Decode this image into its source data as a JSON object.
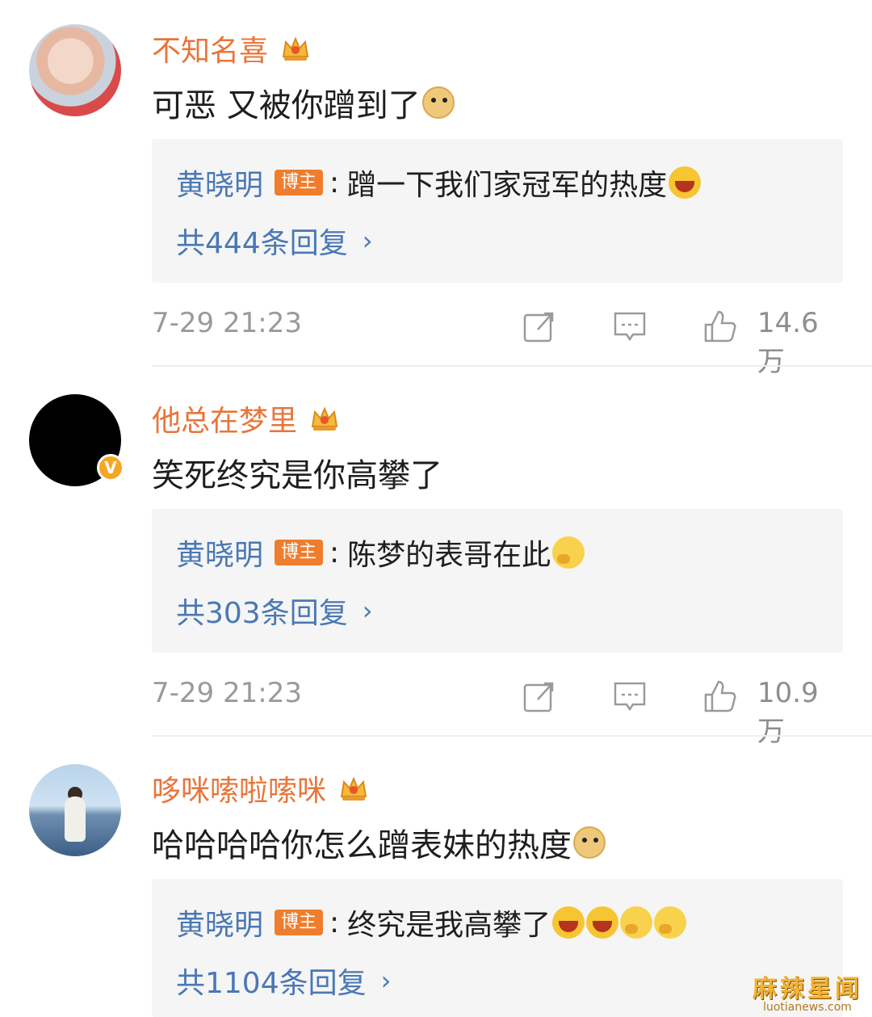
{
  "comments": [
    {
      "username": "不知名喜",
      "text": "可恶 又被你蹭到了",
      "reply": {
        "author": "黄晓明",
        "badge": "博主",
        "separator": ":",
        "text": "蹭一下我们家冠军的热度",
        "more": "共444条回复"
      },
      "time": "7-29 21:23",
      "likes": "14.6万"
    },
    {
      "username": "他总在梦里",
      "text": "笑死终究是你高攀了",
      "reply": {
        "author": "黄晓明",
        "badge": "博主",
        "separator": ":",
        "text": "陈梦的表哥在此",
        "more": "共303条回复"
      },
      "time": "7-29 21:23",
      "likes": "10.9万"
    },
    {
      "username": "哆咪嗦啦嗦咪",
      "text": "哈哈哈哈你怎么蹭表妹的热度",
      "reply": {
        "author": "黄晓明",
        "badge": "博主",
        "separator": ":",
        "text": "终究是我高攀了",
        "more": "共1104条回复"
      }
    }
  ],
  "watermark": {
    "main": "麻辣星闻",
    "sub": "luotianews.com"
  },
  "colors": {
    "username": "#e8753a",
    "reply_author": "#4a78b4",
    "badge": "#ef7d2d",
    "meta": "#9a9a9a"
  },
  "icons": [
    "crown-icon",
    "share-icon",
    "comment-icon",
    "like-icon",
    "verified-icon",
    "chevron-right-icon"
  ]
}
